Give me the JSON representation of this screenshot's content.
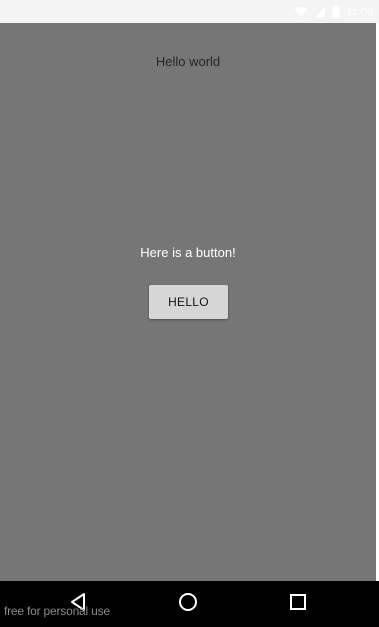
{
  "status_bar": {
    "time": "11:00",
    "icons": [
      "wifi-icon",
      "signal-icon",
      "battery-icon"
    ]
  },
  "main": {
    "title_text": "Hello world",
    "prompt_text": "Here is a button!",
    "button_label": "HELLO"
  },
  "nav_bar": {
    "buttons": [
      "back-icon",
      "home-icon",
      "recent-apps-icon"
    ]
  },
  "watermark": "free for personal use",
  "colors": {
    "background": "#767676",
    "button": "#d6d6d6",
    "nav_bar": "#000000"
  }
}
